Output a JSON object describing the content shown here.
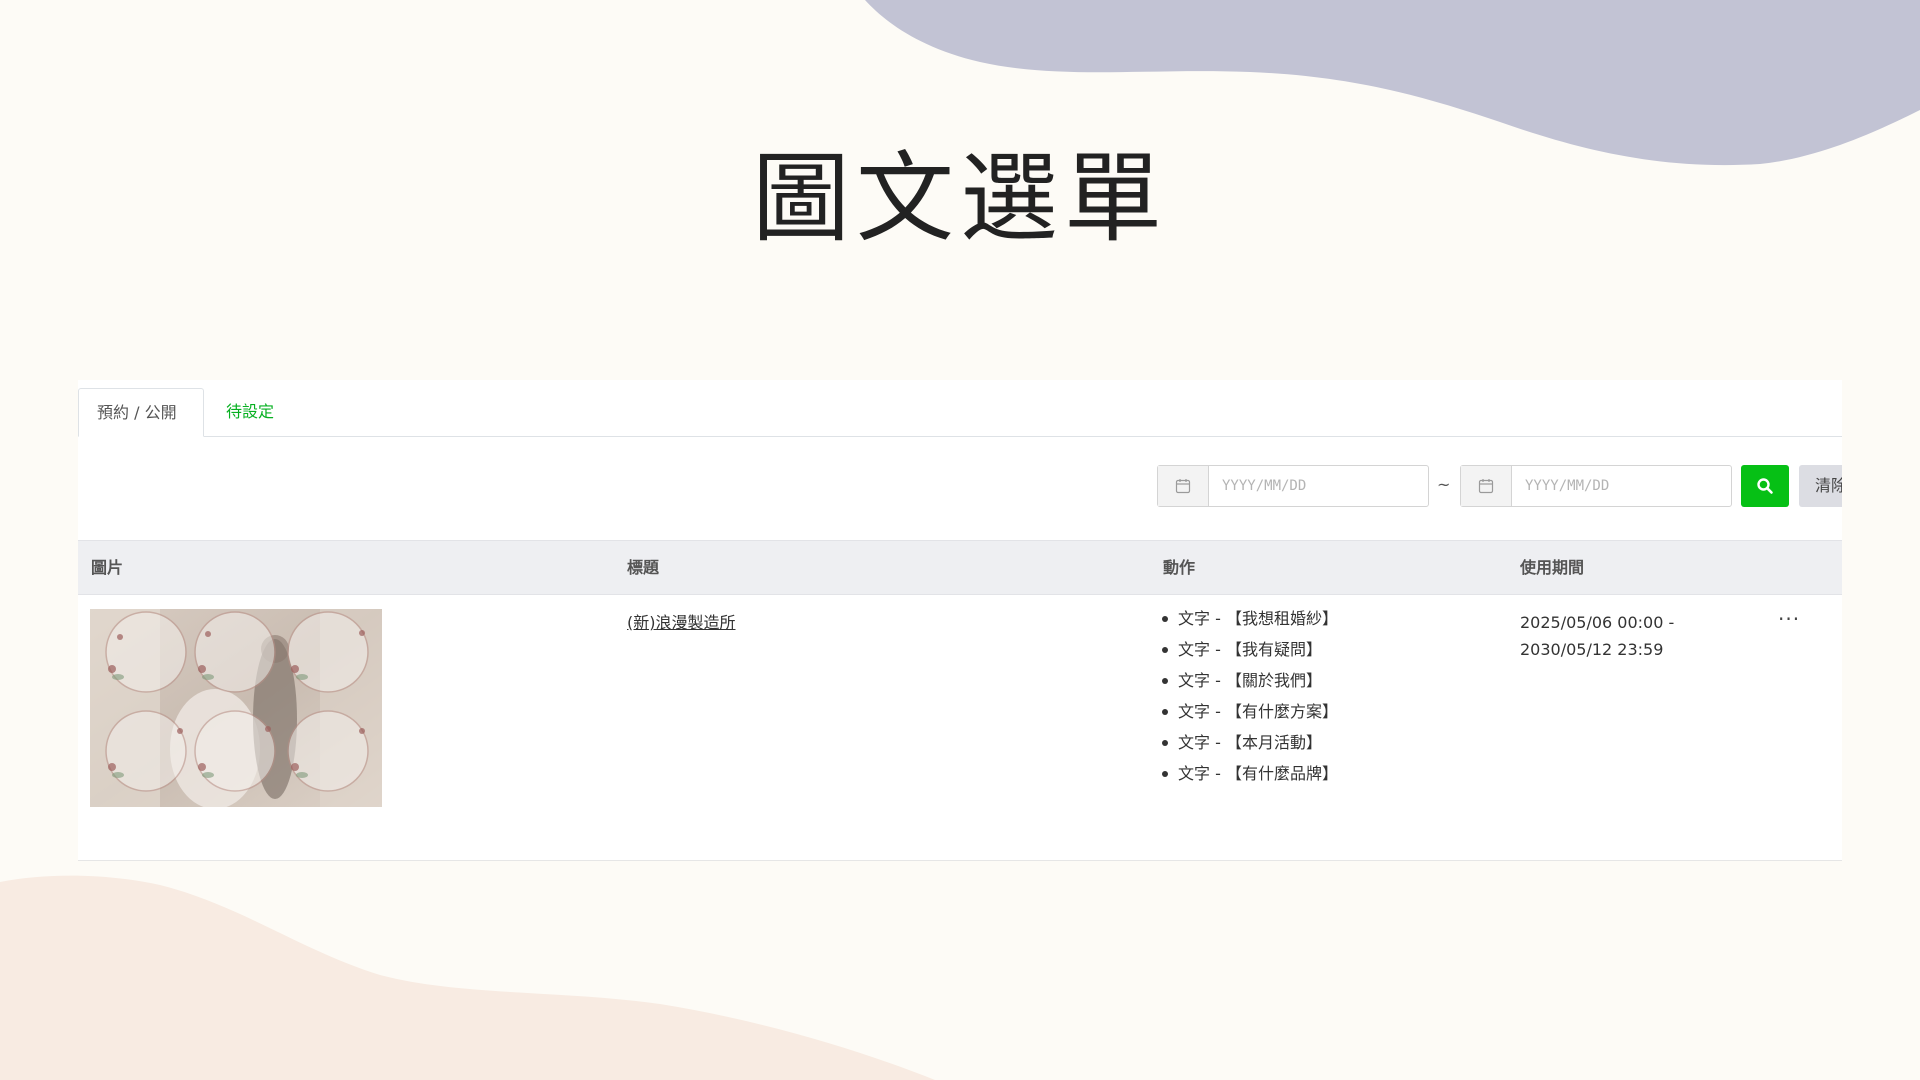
{
  "slide": {
    "title": "圖文選單"
  },
  "colors": {
    "background": "#fdfbf6",
    "wave_top": "#c2c3d4",
    "wave_bottom": "#f8ebe2",
    "accent_green": "#06c015",
    "tab_pending_green": "#06b020"
  },
  "tabs": [
    {
      "label": "預約 / 公開",
      "active": true
    },
    {
      "label": "待設定",
      "active": false
    }
  ],
  "filter": {
    "start_placeholder": "YYYY/MM/DD",
    "end_placeholder": "YYYY/MM/DD",
    "separator": "~",
    "search_icon": "search-icon",
    "calendar_icon": "calendar-icon",
    "clear_label": "清除"
  },
  "table": {
    "headers": [
      "圖片",
      "標題",
      "動作",
      "使用期間"
    ],
    "rows": [
      {
        "title": "(新)浪漫製造所",
        "actions": [
          "文字 - 【我想租婚紗】",
          "文字 - 【我有疑問】",
          "文字 - 【關於我們】",
          "文字 - 【有什麼方案】",
          "文字 - 【本月活動】",
          "文字 - 【有什麼品牌】"
        ],
        "period_start": "2025/05/06 00:00 -",
        "period_end": "2030/05/12 23:59",
        "more": "···"
      }
    ]
  }
}
